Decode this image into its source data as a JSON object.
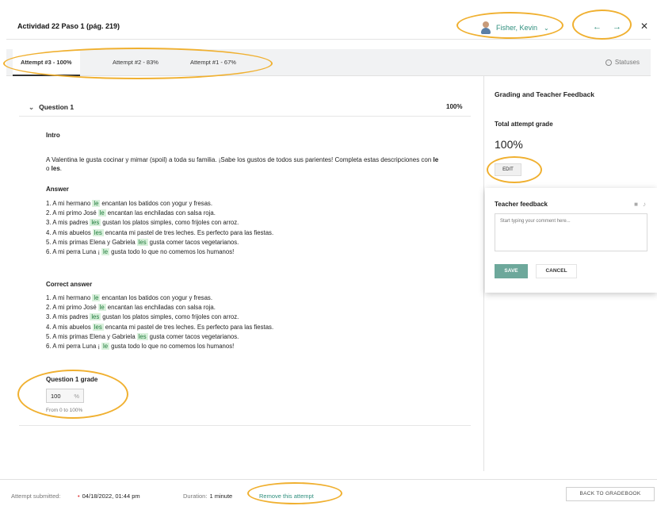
{
  "header": {
    "title": "Actividad 22 Paso 1 (pág. 219)",
    "user_name": "Fisher, Kevin",
    "prev_arrow": "←",
    "next_arrow": "→",
    "close": "✕"
  },
  "tabs": [
    {
      "label": "Attempt #3 - 100%"
    },
    {
      "label": "Attempt #2 - 83%"
    },
    {
      "label": "Attempt #1 - 67%"
    }
  ],
  "statuses_label": "Statuses",
  "question": {
    "title": "Question 1",
    "score": "100%",
    "intro_label": "Intro",
    "intro_text_a": "A Valentina le gusta cocinar y mimar (spoil) a toda su familia. ¡Sabe los gustos de todos sus parientes! Completa estas descripciones con ",
    "intro_le": "le",
    "intro_o": " o ",
    "intro_les": "les",
    "intro_end": ".",
    "answer_label": "Answer",
    "correct_label": "Correct answer",
    "lines": [
      {
        "pre": "1. A mi hermano",
        "word": "le",
        "post": "encantan los batidos con yogur y fresas."
      },
      {
        "pre": "2. A mi primo José",
        "word": "le",
        "post": "encantan las enchiladas con salsa roja."
      },
      {
        "pre": "3. A mis padres",
        "word": "les",
        "post": "gustan los platos simples, como frijoles con arroz."
      },
      {
        "pre": "4. A mis abuelos",
        "word": "les",
        "post": "encanta mi pastel de tres leches. Es perfecto para las fiestas."
      },
      {
        "pre": "5. A mis primas Elena y Gabriela",
        "word": "les",
        "post": "gusta comer tacos vegetarianos."
      },
      {
        "pre": "6. A mi perra Luna ¡",
        "word": "le",
        "post": "gusta todo lo que no comemos los humanos!"
      }
    ],
    "grade_label": "Question 1 grade",
    "grade_value": "100",
    "grade_unit": "%",
    "grade_range": "From 0 to 100%"
  },
  "right_panel": {
    "title": "Grading and Teacher Feedback",
    "total_label": "Total attempt grade",
    "total_value": "100%",
    "edit_label": "EDIT",
    "feedback_title": "Teacher feedback",
    "feedback_placeholder": "Start typing your comment here...",
    "save_label": "SAVE",
    "cancel_label": "CANCEL"
  },
  "footer": {
    "submitted_label": "Attempt submitted:",
    "submitted_date": "04/18/2022, 01:44 pm",
    "duration_label": "Duration:",
    "duration_value": "1 minute",
    "remove_label": "Remove this attempt",
    "back_label": "BACK TO GRADEBOOK"
  },
  "colors": {
    "accent": "#2f8f7e",
    "highlight_bg": "#d9f1dc",
    "annotation": "#f0b030",
    "save_button": "#6da89b"
  }
}
